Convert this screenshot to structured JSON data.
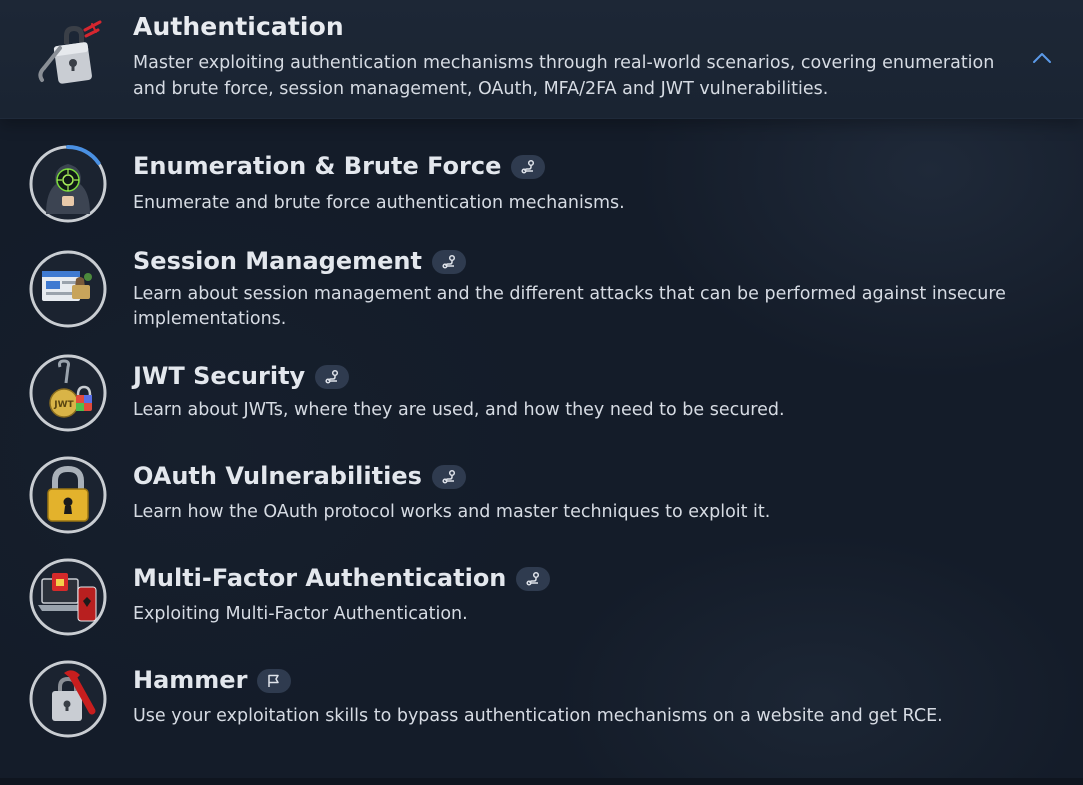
{
  "module": {
    "title": "Authentication",
    "description": "Master exploiting authentication mechanisms through real-world scenarios, covering enumeration and brute force, session management, OAuth, MFA/2FA and JWT vulnerabilities.",
    "icon": "padlock-crowbar-icon",
    "collapse_icon": "chevron-up-icon"
  },
  "rooms": [
    {
      "title": "Enumeration & Brute Force",
      "description": "Enumerate and brute force authentication mechanisms.",
      "icon": "hacker-hood-icon",
      "badge_icon": "path-icon",
      "progress": 0.3
    },
    {
      "title": "Session Management",
      "description": "Learn about session management and the different attacks that can be performed against insecure implementations.",
      "icon": "browser-session-icon",
      "badge_icon": "path-icon"
    },
    {
      "title": "JWT Security",
      "description": "Learn about JWTs, where they are used, and how they need to be secured.",
      "icon": "jwt-lock-icon",
      "badge_icon": "path-icon"
    },
    {
      "title": "OAuth Vulnerabilities",
      "description": "Learn how the OAuth protocol works and master techniques to exploit it.",
      "icon": "golden-padlock-icon",
      "badge_icon": "path-icon"
    },
    {
      "title": "Multi-Factor Authentication",
      "description": "Exploiting Multi-Factor Authentication.",
      "icon": "laptop-mfa-icon",
      "badge_icon": "path-icon"
    },
    {
      "title": "Hammer",
      "description": "Use your exploitation skills to bypass authentication mechanisms on a website and get RCE.",
      "icon": "padlock-wrench-icon",
      "badge_icon": "flag-icon"
    }
  ],
  "colors": {
    "background": "#141c29",
    "header_background": "#1d2736",
    "badge_background": "#2f3b4f",
    "accent": "#4a90e2",
    "text": "#dfe3ea"
  }
}
